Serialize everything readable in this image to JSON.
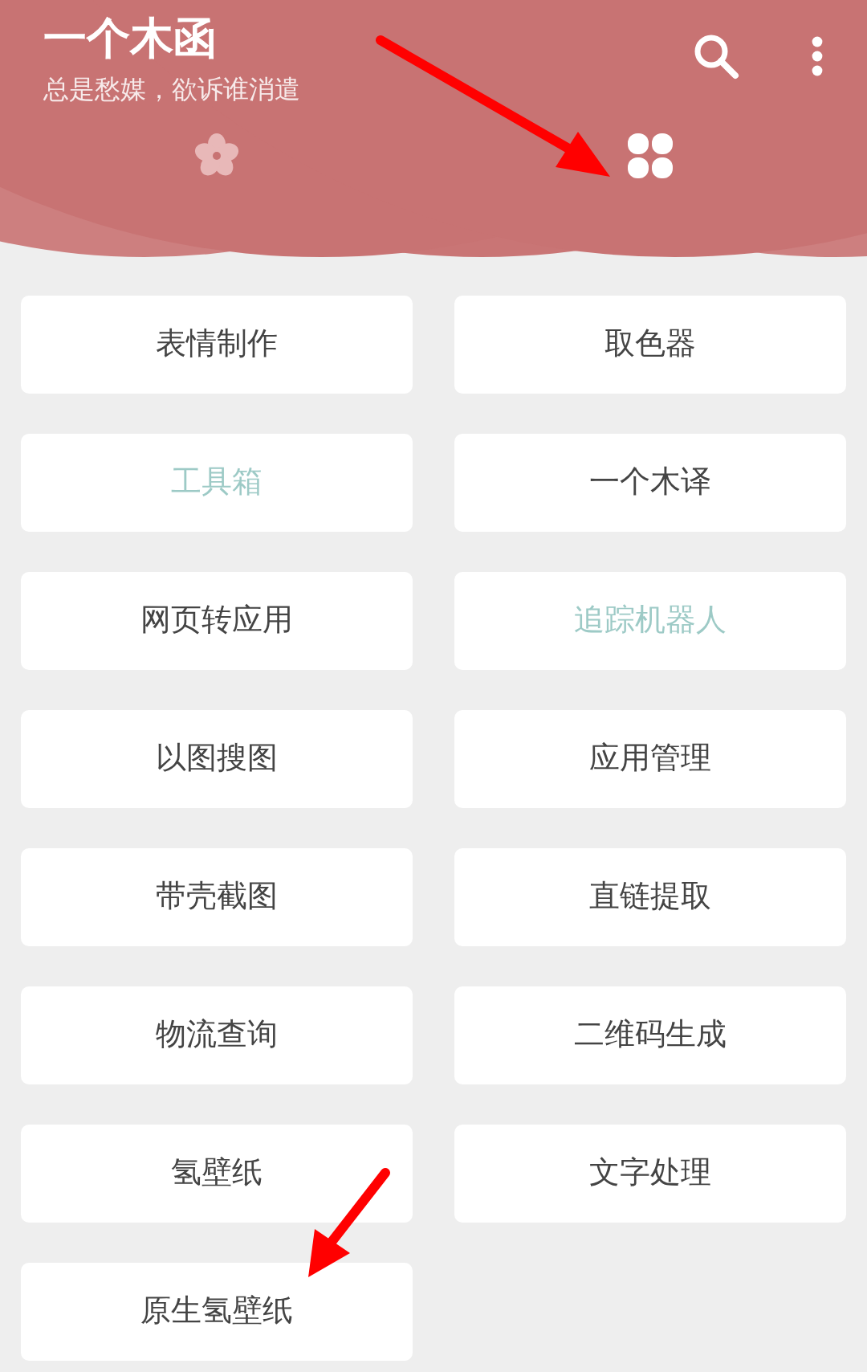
{
  "app_bar": {
    "title": "一个木函",
    "subtitle": "总是愁媒，欲诉谁消遣"
  },
  "tabs": [
    {
      "kind": "flower",
      "selected": false
    },
    {
      "kind": "clover",
      "selected": true
    }
  ],
  "tools": [
    {
      "label": "表情制作",
      "accent": false
    },
    {
      "label": "取色器",
      "accent": false
    },
    {
      "label": "工具箱",
      "accent": true
    },
    {
      "label": "一个木译",
      "accent": false
    },
    {
      "label": "网页转应用",
      "accent": false
    },
    {
      "label": "追踪机器人",
      "accent": true
    },
    {
      "label": "以图搜图",
      "accent": false
    },
    {
      "label": "应用管理",
      "accent": false
    },
    {
      "label": "带壳截图",
      "accent": false
    },
    {
      "label": "直链提取",
      "accent": false
    },
    {
      "label": "物流查询",
      "accent": false
    },
    {
      "label": "二维码生成",
      "accent": false
    },
    {
      "label": "氢壁纸",
      "accent": false
    },
    {
      "label": "文字处理",
      "accent": false
    },
    {
      "label": "原生氢壁纸",
      "accent": false
    }
  ]
}
